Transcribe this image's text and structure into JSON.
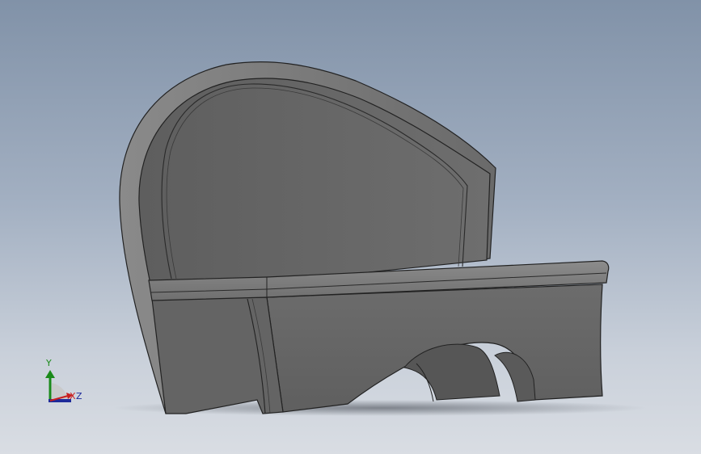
{
  "viewport": {
    "background_top": "#8192a8",
    "background_bottom": "#d9dde3",
    "model_fill": "#6b6b6b",
    "model_edge": "#222222"
  },
  "triad": {
    "y_label": "Y",
    "x_label": "X",
    "z_label": "Z",
    "y_color": "#1a8a1a",
    "x_color": "#c81e1e",
    "z_color": "#1e2a9a"
  }
}
